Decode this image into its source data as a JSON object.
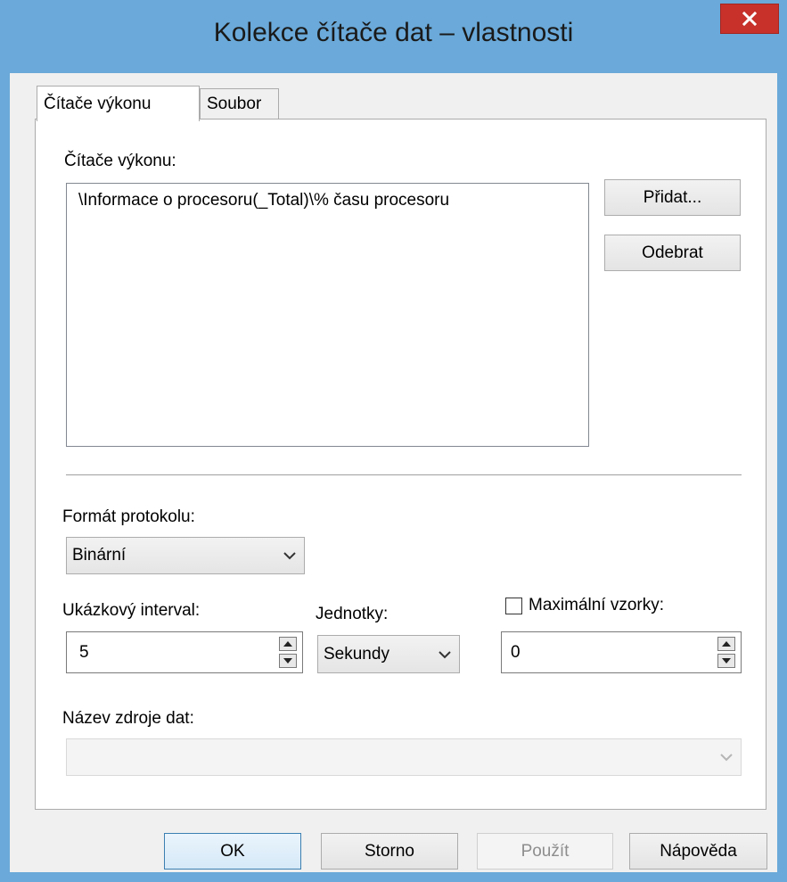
{
  "window": {
    "title": "Kolekce čítače dat – vlastnosti"
  },
  "tabs": [
    {
      "label": "Čítače výkonu",
      "active": true
    },
    {
      "label": "Soubor",
      "active": false
    }
  ],
  "counters": {
    "label": "Čítače výkonu:",
    "items": [
      "\\Informace o procesoru(_Total)\\% času procesoru"
    ],
    "add_label": "Přidat...",
    "remove_label": "Odebrat"
  },
  "log_format": {
    "label": "Formát protokolu:",
    "value": "Binární"
  },
  "sample_interval": {
    "label": "Ukázkový interval:",
    "value": "5"
  },
  "units": {
    "label": "Jednotky:",
    "value": "Sekundy"
  },
  "max_samples": {
    "label": "Maximální vzorky:",
    "checked": false,
    "value": "0"
  },
  "data_source": {
    "label": "Název zdroje dat:",
    "value": "",
    "enabled": false
  },
  "buttons": {
    "ok": "OK",
    "cancel": "Storno",
    "apply": "Použít",
    "help": "Nápověda"
  },
  "icons": {
    "close": "close-icon",
    "dropdown": "chevron-down-icon",
    "spin_up": "arrow-up-icon",
    "spin_down": "arrow-down-icon"
  },
  "colors": {
    "titlebar": "#6aa9d9",
    "close": "#c7312a",
    "dialog": "#f0f0f0"
  }
}
